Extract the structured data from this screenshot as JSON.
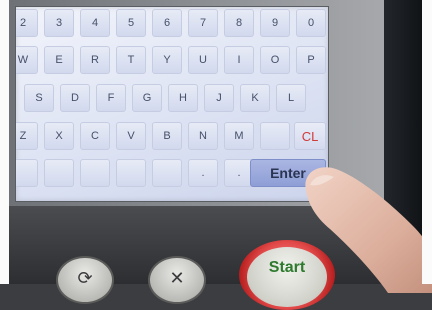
{
  "keyboard": {
    "rows": [
      [
        "2",
        "3",
        "4",
        "5",
        "6",
        "7",
        "8",
        "9",
        "0"
      ],
      [
        "W",
        "E",
        "R",
        "T",
        "Y",
        "U",
        "I",
        "O",
        "P"
      ],
      [
        "S",
        "D",
        "F",
        "G",
        "H",
        "J",
        "K",
        "L"
      ],
      [
        "Z",
        "X",
        "C",
        "V",
        "B",
        "N",
        "M"
      ],
      [
        ".",
        "."
      ]
    ],
    "clear_label": "CL",
    "enter_label": "Enter"
  },
  "panel": {
    "start_label": "Start",
    "reset_icon": "rotate-arrow-icon",
    "cancel_icon": "x-icon"
  }
}
